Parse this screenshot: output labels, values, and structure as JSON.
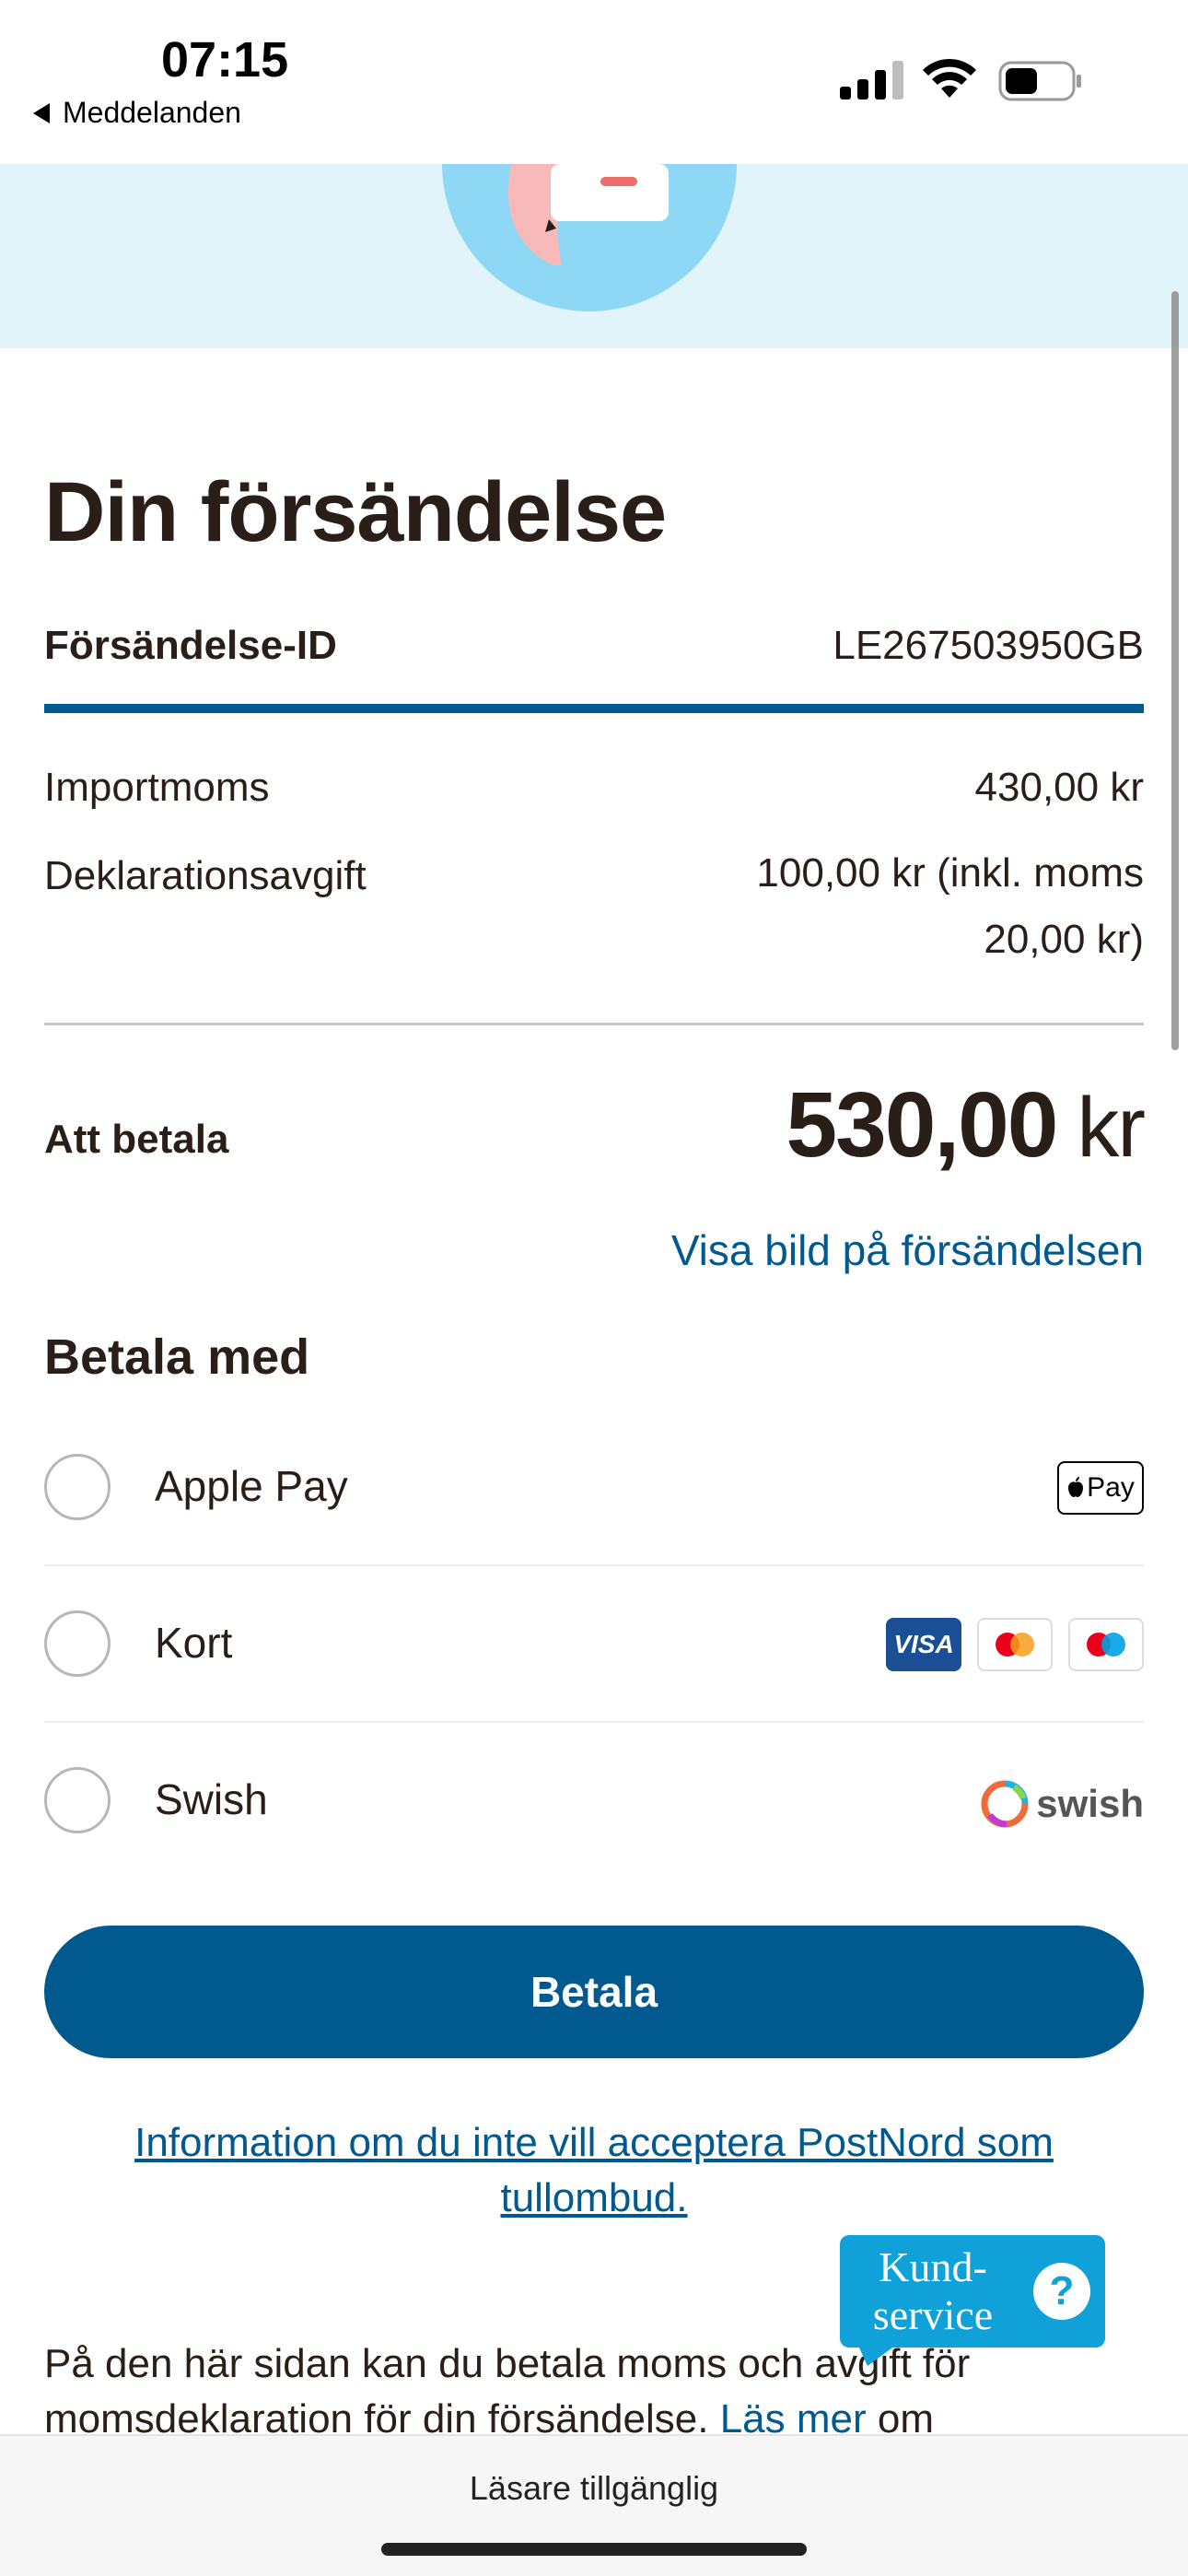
{
  "status_bar": {
    "time": "07:15",
    "back_label": "Meddelanden"
  },
  "hero": {
    "illustration": "package-illustration"
  },
  "shipment": {
    "heading": "Din försändelse",
    "id_label": "Försändelse-ID",
    "id_value": "LE267503950GB",
    "lines": [
      {
        "label": "Importmoms",
        "value": "430,00 kr"
      },
      {
        "label": "Deklarationsavgift",
        "value_line1": "100,00 kr (inkl. moms",
        "value_line2": "20,00 kr)"
      }
    ],
    "total_label": "Att betala",
    "total_amount": "530,00",
    "total_unit": "kr",
    "image_link": "Visa bild på försändelsen"
  },
  "payment": {
    "heading": "Betala med",
    "options": [
      {
        "label": "Apple Pay",
        "logo": "Pay"
      },
      {
        "label": "Kort",
        "logos": [
          "VISA",
          "mastercard",
          "maestro"
        ]
      },
      {
        "label": "Swish",
        "logo": "swish"
      }
    ],
    "button_label": "Betala"
  },
  "info_link": "Information om du inte vill acceptera PostNord som tullombud.",
  "customer_service": {
    "line1": "Kund-",
    "line2": "service",
    "icon": "?"
  },
  "paragraph": {
    "text1": "På den här sidan kan du betala moms och avgift för momsdeklaration för din försändelse. ",
    "link": "Läs mer",
    "text2": " om"
  },
  "bottom_bar": {
    "reader_label": "Läsare tillgänglig"
  },
  "colors": {
    "brand_blue": "#00598f",
    "hero_bg": "#e0f4f9",
    "kundservice_bg": "#0fa1d8",
    "text": "#2a1f18"
  }
}
